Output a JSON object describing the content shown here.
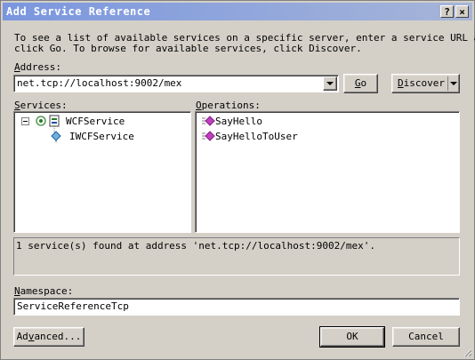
{
  "window": {
    "title": "Add Service Reference",
    "help_button": "?",
    "close_button": "×"
  },
  "instructions": {
    "line1": "To see a list of available services on a specific server, enter a service URL and",
    "line2": "click Go. To browse for available services, click Discover."
  },
  "address": {
    "label_accel": "A",
    "label_rest": "ddress:",
    "value": "net.tcp://localhost:9002/mex",
    "go_accel": "G",
    "go_rest": "o",
    "discover_accel": "D",
    "discover_rest": "iscover"
  },
  "services": {
    "label_accel": "S",
    "label_rest": "ervices:",
    "tree": [
      {
        "label": "WCFService",
        "expanded": true,
        "icon": "service-icon"
      },
      {
        "label": "IWCFService",
        "icon": "interface-icon"
      }
    ]
  },
  "operations": {
    "label_accel": "O",
    "label_rest": "perations:",
    "items": [
      "SayHello",
      "SayHelloToUser"
    ]
  },
  "status_text": "1 service(s) found at address 'net.tcp://localhost:9002/mex'.",
  "namespace": {
    "label_accel": "N",
    "label_rest": "amespace:",
    "value": "ServiceReferenceTcp"
  },
  "buttons": {
    "advanced_prefix": "Ad",
    "advanced_accel": "v",
    "advanced_rest": "anced...",
    "ok": "OK",
    "cancel": "Cancel"
  }
}
